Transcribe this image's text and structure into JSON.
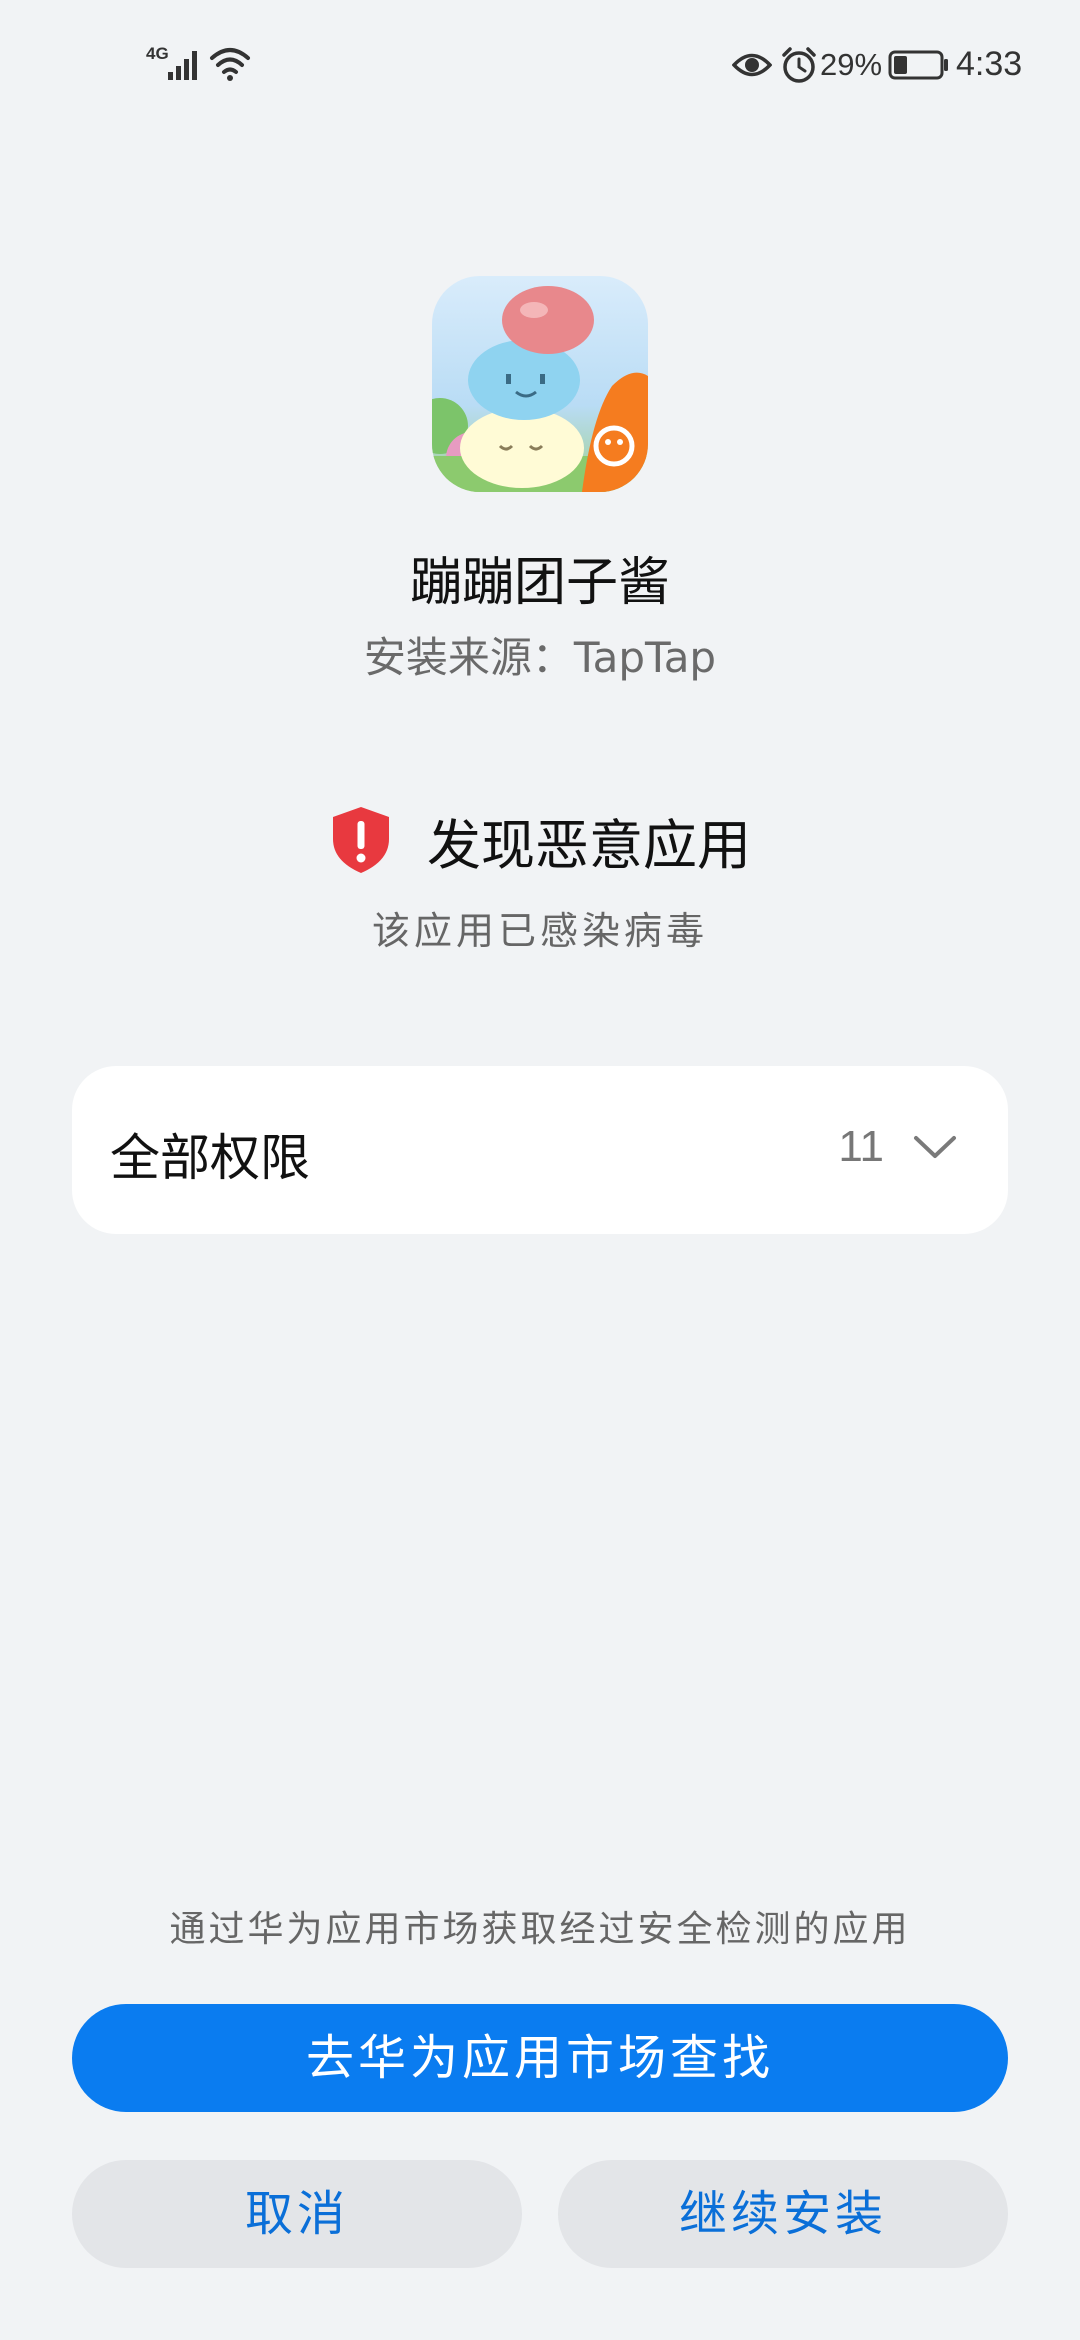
{
  "status_bar": {
    "network": "4G",
    "battery_percent": "29%",
    "battery_level": 0.29,
    "time": "4:33",
    "icons": [
      "signal-icon",
      "wifi-icon",
      "eye-icon",
      "alarm-icon",
      "battery-icon"
    ]
  },
  "app": {
    "name": "蹦蹦团子酱",
    "install_source": "安装来源：TapTap",
    "icon": "app-icon"
  },
  "warning": {
    "title": "发现恶意应用",
    "subtitle": "该应用已感染病毒",
    "icon": "shield-alert-icon",
    "color": "#e8393f"
  },
  "permissions": {
    "label": "全部权限",
    "count": "11",
    "icon": "chevron-down-icon"
  },
  "footer": {
    "tip": "通过华为应用市场获取经过安全检测的应用",
    "primary_button": "去华为应用市场查找",
    "cancel_button": "取消",
    "continue_button": "继续安装"
  },
  "colors": {
    "background": "#f1f3f5",
    "accent": "#0a7cf0",
    "secondary_button_bg": "#e3e5e8",
    "secondary_button_text": "#0a6fd8"
  }
}
